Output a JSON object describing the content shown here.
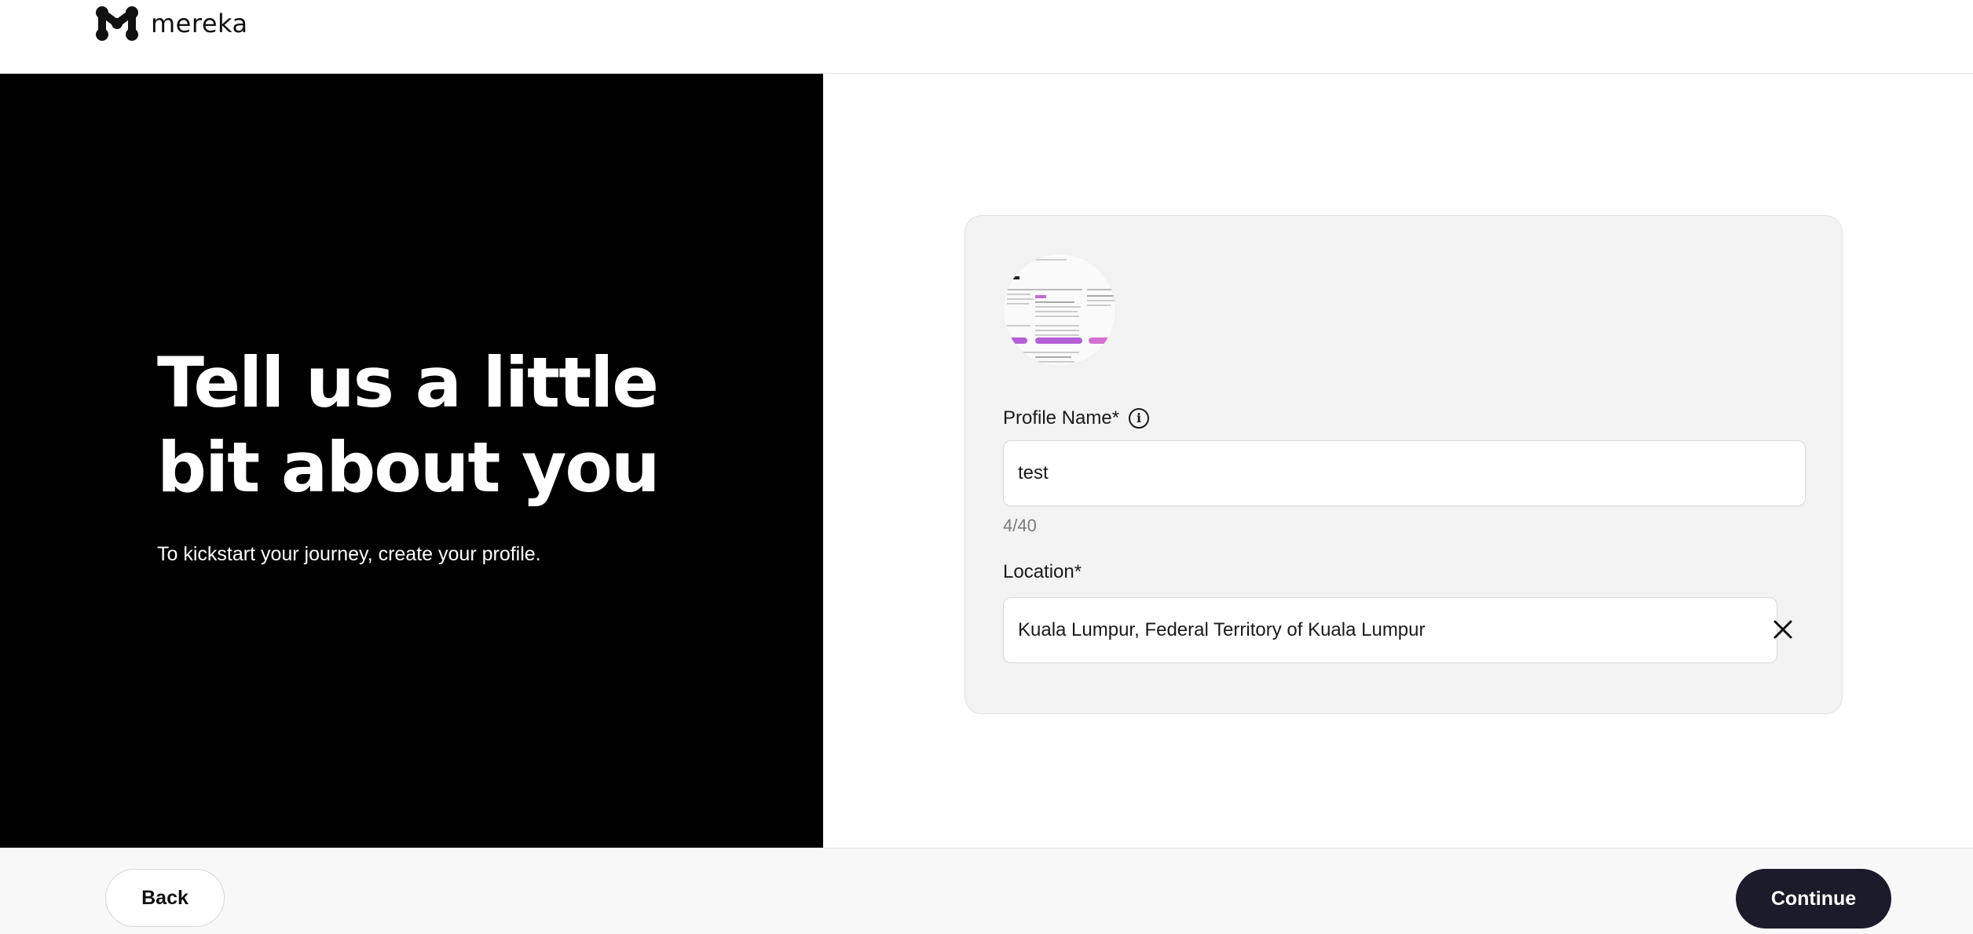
{
  "brand": {
    "name": "mereka",
    "logo_icon": "mereka-logo-icon"
  },
  "hero": {
    "title": "Tell us a little bit about you",
    "subtitle": "To kickstart your journey, create your profile."
  },
  "form": {
    "profile_name": {
      "label": "Profile Name*",
      "value": "test",
      "counter": "4/40",
      "info_icon": "info-icon"
    },
    "location": {
      "label": "Location*",
      "value": "Kuala Lumpur, Federal Territory of Kuala Lumpur",
      "clear_icon": "close-icon"
    }
  },
  "footer": {
    "back_label": "Back",
    "continue_label": "Continue"
  },
  "colors": {
    "left_panel": "#000000",
    "primary_button": "#1c1b2a",
    "card_bg": "#f3f3f3"
  }
}
